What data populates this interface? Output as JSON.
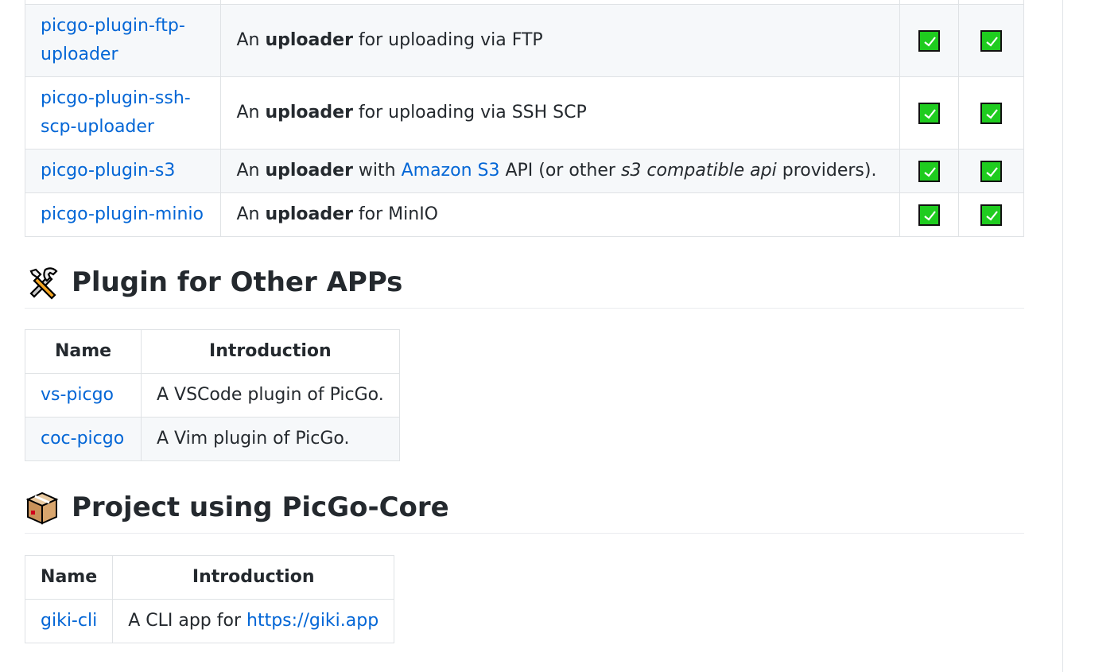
{
  "plugin_rows": [
    {
      "name": "picgo-plugin-ftp-uploader",
      "name_line1": "picgo-plugin-ftp-",
      "name_line2": "uploader",
      "desc_pre": "An ",
      "desc_bold": "uploader",
      "desc_post": " for uploading via FTP",
      "check1": true,
      "check2": true
    },
    {
      "name": "picgo-plugin-ssh-scp-uploader",
      "name_line1": "picgo-plugin-ssh-",
      "name_line2": "scp-uploader",
      "desc_pre": "An ",
      "desc_bold": "uploader",
      "desc_post": " for uploading via SSH SCP",
      "check1": true,
      "check2": true
    },
    {
      "name": "picgo-plugin-s3",
      "desc_pre": "An ",
      "desc_bold": "uploader",
      "desc_mid": " with ",
      "desc_link": "Amazon S3",
      "desc_mid2": " API (or other ",
      "desc_italic": "s3 compatible api",
      "desc_post": " providers).",
      "check1": true,
      "check2": true
    },
    {
      "name": "picgo-plugin-minio",
      "desc_pre": "An ",
      "desc_bold": "uploader",
      "desc_post": " for MinIO",
      "check1": true,
      "check2": true
    }
  ],
  "other_apps": {
    "heading": "Plugin for Other APPs",
    "icon": "hammer-and-wrench-icon",
    "columns": [
      "Name",
      "Introduction"
    ],
    "rows": [
      {
        "name": "vs-picgo",
        "intro": "A VSCode plugin of PicGo."
      },
      {
        "name": "coc-picgo",
        "intro": "A Vim plugin of PicGo."
      }
    ]
  },
  "projects": {
    "heading": "Project using PicGo-Core",
    "icon": "package-icon",
    "columns": [
      "Name",
      "Introduction"
    ],
    "rows": [
      {
        "name": "giki-cli",
        "intro_pre": "A CLI app for ",
        "intro_link": "https://giki.app"
      }
    ]
  },
  "colors": {
    "link": "#0366d6",
    "check_green": "#1fcc1f",
    "row_alt": "#f6f8fa",
    "border": "#dfe2e5"
  }
}
